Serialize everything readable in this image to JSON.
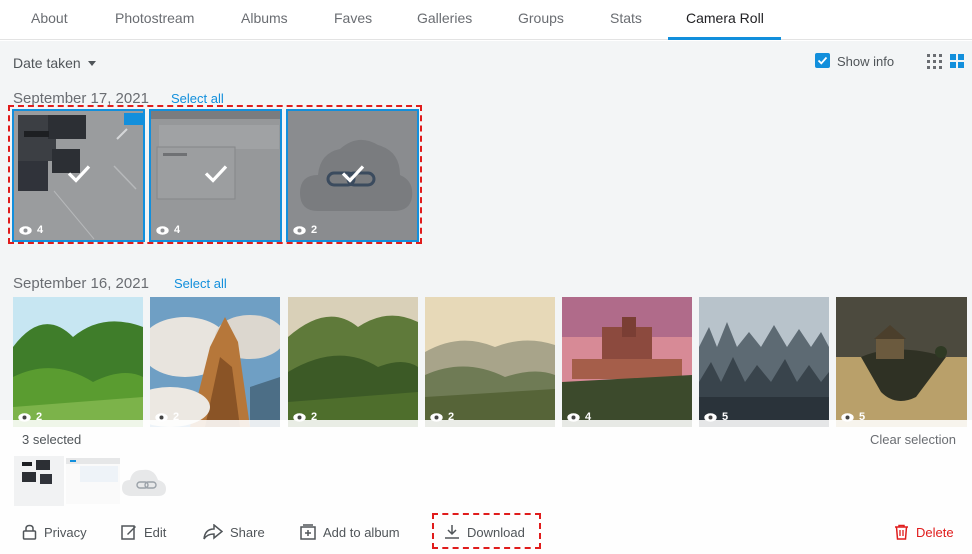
{
  "nav": {
    "tabs": [
      "About",
      "Photostream",
      "Albums",
      "Faves",
      "Galleries",
      "Groups",
      "Stats",
      "Camera Roll"
    ],
    "active": "Camera Roll"
  },
  "toolbar": {
    "sort_label": "Date taken",
    "show_info_label": "Show info",
    "show_info_checked": true
  },
  "sections": [
    {
      "date": "September 17, 2021",
      "select_all": "Select all",
      "photos": [
        {
          "views": "4",
          "selected": true
        },
        {
          "views": "4",
          "selected": true
        },
        {
          "views": "2",
          "selected": true
        }
      ]
    },
    {
      "date": "September 16, 2021",
      "select_all": "Select all",
      "photos": [
        {
          "views": "2"
        },
        {
          "views": "2"
        },
        {
          "views": "2"
        },
        {
          "views": "2"
        },
        {
          "views": "4"
        },
        {
          "views": "5"
        },
        {
          "views": "5"
        }
      ]
    }
  ],
  "selection_bar": {
    "count_label": "3 selected",
    "clear_label": "Clear selection",
    "actions": {
      "privacy": "Privacy",
      "edit": "Edit",
      "share": "Share",
      "add_to_album": "Add to album",
      "download": "Download",
      "delete": "Delete"
    }
  },
  "colors": {
    "accent": "#128fdc",
    "highlight": "#e01c1c"
  }
}
